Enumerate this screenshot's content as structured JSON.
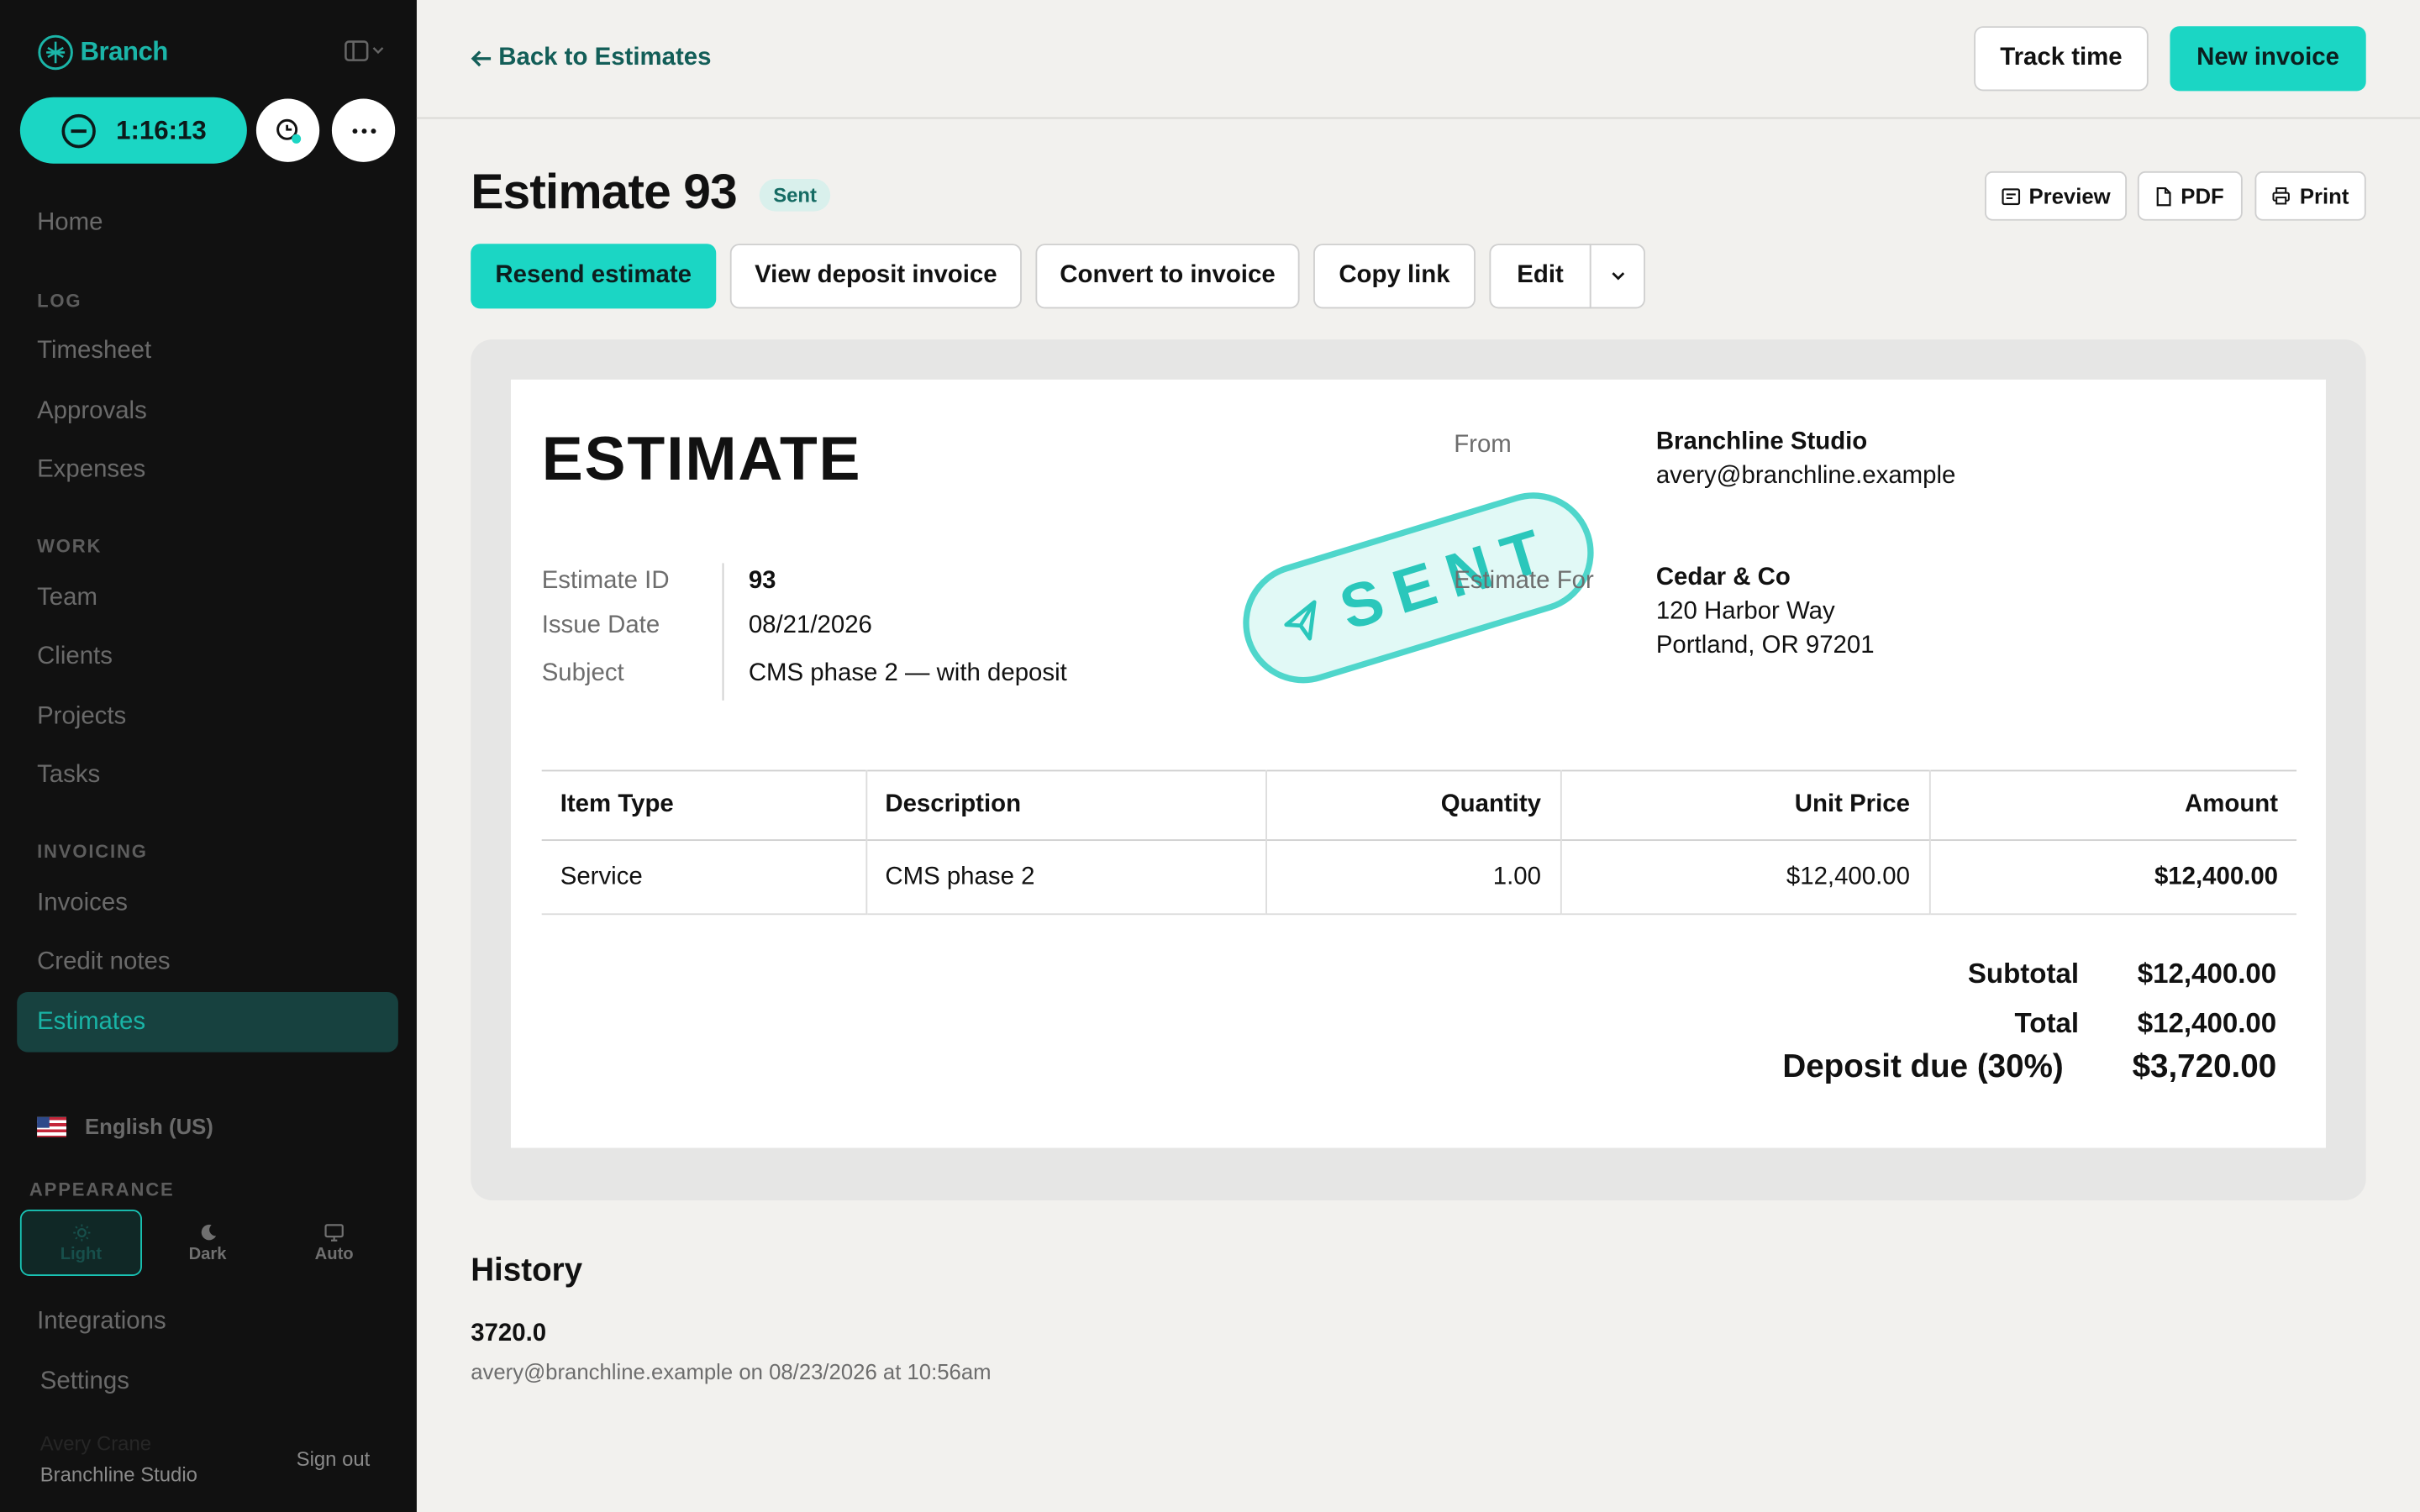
{
  "sidebar": {
    "brand": "Branch",
    "timer": "1:16:13",
    "home": "Home",
    "sections": {
      "log": "LOG",
      "work": "WORK",
      "invoicing": "INVOICING",
      "appearance": "APPEARANCE"
    },
    "log_items": [
      "Timesheet",
      "Approvals",
      "Expenses"
    ],
    "work_items": [
      "Team",
      "Clients",
      "Projects",
      "Tasks"
    ],
    "invoicing_items": [
      "Invoices",
      "Credit notes",
      "Estimates"
    ],
    "language": "English (US)",
    "appearance_options": [
      "Light",
      "Dark",
      "Auto"
    ],
    "integrations": "Integrations",
    "settings": "Settings",
    "user_name": "Avery Crane",
    "user_org": "Branchline Studio",
    "sign_out": "Sign out"
  },
  "topbar": {
    "back": "Back to Estimates",
    "track_time": "Track time",
    "new_invoice": "New invoice"
  },
  "header": {
    "title": "Estimate 93",
    "status": "Sent",
    "preview": "Preview",
    "pdf": "PDF",
    "print": "Print"
  },
  "actions": {
    "resend": "Resend estimate",
    "deposit": "View deposit invoice",
    "convert": "Convert to invoice",
    "copy": "Copy link",
    "edit": "Edit"
  },
  "document": {
    "heading": "ESTIMATE",
    "stamp": "SENT",
    "meta": [
      {
        "label": "Estimate ID",
        "value": "93"
      },
      {
        "label": "Issue Date",
        "value": "08/21/2026"
      },
      {
        "label": "Subject",
        "value": "CMS phase 2 — with deposit"
      }
    ],
    "from_label": "From",
    "from_name": "Branchline Studio",
    "from_email": "avery@branchline.example",
    "for_label": "Estimate For",
    "for_name": "Cedar & Co",
    "for_street": "120 Harbor Way",
    "for_city": "Portland, OR 97201",
    "columns": [
      "Item Type",
      "Description",
      "Quantity",
      "Unit Price",
      "Amount"
    ],
    "rows": [
      [
        "Service",
        "CMS phase 2",
        "1.00",
        "$12,400.00",
        "$12,400.00"
      ]
    ],
    "subtotal_label": "Subtotal",
    "subtotal": "$12,400.00",
    "total_label": "Total",
    "total": "$12,400.00",
    "deposit_label": "Deposit due (30%)",
    "deposit": "$3,720.00"
  },
  "history": {
    "title": "History",
    "entries": [
      {
        "amount": "3720.0",
        "meta": "avery@branchline.example on 08/23/2026 at 10:56am"
      }
    ]
  },
  "colors": {
    "accent": "#1bd6c4",
    "sidebar_bg": "#111111",
    "active_item_bg": "#17413f",
    "page_bg": "#f2f1ee"
  }
}
